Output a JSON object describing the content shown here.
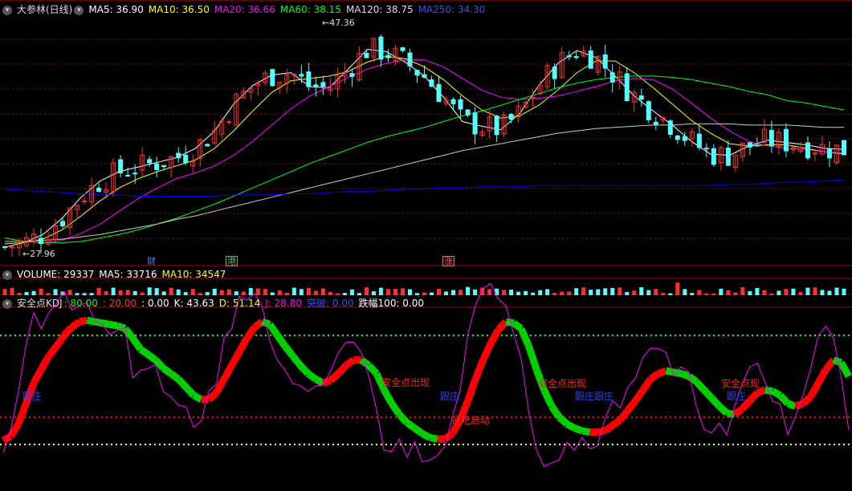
{
  "colors": {
    "background": "#000000",
    "grid": "#7a1010",
    "divider": "#b00000",
    "up_candle": "#ff3030",
    "down_candle": "#54ffff",
    "ma5": "#ffffff",
    "ma10": "#ffff00",
    "ma20": "#ff00ff",
    "ma60": "#00ff00",
    "ma120": "#cccccc",
    "ma250": "#0000ff",
    "kdj_line": "#ff00ff",
    "kdj_up": "#ff0000",
    "kdj_down": "#00d000",
    "level_80": "#00ff00",
    "level_20": "#ff0000",
    "level_0": "#ffff00"
  },
  "price_header": {
    "collapse_icon": "chevron-down-icon",
    "title": "大参林(日线)",
    "ma5": "MA5: 36.90",
    "ma10": "MA10: 36.50",
    "ma20": "MA20: 36.66",
    "ma60": "MA60: 38.15",
    "ma120": "MA120: 38.75",
    "ma250": "MA250: 34.30"
  },
  "volume_header": {
    "collapse_icon": "chevron-down-icon",
    "volume": "VOLUME: 29337",
    "ma5": "MA5: 33716",
    "ma10": "MA10: 34547"
  },
  "kdj_header": {
    "collapse_icon": "chevron-down-icon",
    "title": "安全点KDJ",
    "p80": ": 80.00",
    "p20": ": 20.00",
    "p0": ": 0.00",
    "k": "K: 43.63",
    "d": "D: 51.14",
    "j": "J: 28.80",
    "tp": "突破: 0.00",
    "zf": "跌幅100: 0.00"
  },
  "price_labels": {
    "high": "47.36",
    "low": "27.96"
  },
  "event_tags": [
    {
      "text": "财",
      "color": "#4488ff"
    },
    {
      "text": "港",
      "color": "#30d030"
    },
    {
      "text": "涨",
      "color": "#ff6060"
    }
  ],
  "annotations": [
    {
      "text": "跟庄",
      "color": "#3040ff"
    },
    {
      "text": "安全点出现",
      "color": "#ff2020"
    },
    {
      "text": "跟庄",
      "color": "#3040ff"
    },
    {
      "text": "通吃启动",
      "color": "#ff2020"
    },
    {
      "text": "安全点出现",
      "color": "#ff2020"
    },
    {
      "text": "跟庄跟庄",
      "color": "#3040ff"
    },
    {
      "text": "安全点现",
      "color": "#ff2020"
    },
    {
      "text": "跟庄",
      "color": "#3040ff"
    }
  ],
  "chart_data": {
    "type": "candlestick",
    "bars": 117,
    "price_range": [
      27.0,
      48.5
    ],
    "high_value": 47.36,
    "low_value": 27.96,
    "ma_series": [
      {
        "name": "MA5",
        "values": [
          28.5,
          28.9,
          29.6,
          31.0,
          32.8,
          34.2,
          35.0,
          35.4,
          35.8,
          36.2,
          37.0,
          38.5,
          40.8,
          42.4,
          43.3,
          43.5,
          42.3,
          42.2,
          43.8,
          45.5,
          45.3,
          44.4,
          43.2,
          41.4,
          39.3,
          38.9,
          38.6,
          40.0,
          42.4,
          44.3,
          45.4,
          44.8,
          43.2,
          41.5,
          40.2,
          39.0,
          37.6,
          36.5,
          36.4,
          37.2,
          37.7,
          37.5,
          37.3,
          37.0,
          36.9
        ]
      },
      {
        "name": "MA10",
        "values": [
          28.8,
          28.9,
          29.2,
          30.0,
          31.2,
          32.5,
          33.6,
          34.4,
          35.0,
          35.5,
          36.0,
          37.0,
          38.5,
          40.2,
          41.8,
          42.8,
          43.0,
          43.2,
          43.6,
          44.4,
          44.9,
          44.7,
          44.0,
          42.9,
          41.5,
          40.3,
          39.6,
          39.8,
          40.7,
          42.0,
          43.5,
          44.5,
          44.5,
          43.5,
          42.2,
          40.8,
          39.4,
          38.3,
          37.4,
          37.2,
          37.3,
          37.3,
          37.0,
          36.7,
          36.5
        ]
      },
      {
        "name": "MA20",
        "values": [
          29.3,
          29.0,
          28.9,
          29.1,
          29.7,
          30.5,
          31.6,
          32.7,
          33.6,
          34.4,
          34.9,
          35.5,
          36.4,
          37.6,
          39.0,
          40.4,
          41.5,
          42.3,
          43.1,
          43.8,
          44.3,
          44.6,
          44.6,
          44.0,
          43.0,
          42.0,
          41.4,
          41.2,
          41.3,
          41.5,
          41.9,
          42.3,
          42.8,
          43.0,
          42.9,
          42.1,
          40.9,
          39.6,
          38.5,
          37.6,
          37.2,
          37.0,
          36.9,
          36.7,
          36.6
        ]
      },
      {
        "name": "MA60",
        "values": [
          29.3,
          29.0,
          28.9,
          28.9,
          29.0,
          29.3,
          29.6,
          30.0,
          30.5,
          31.0,
          31.6,
          32.2,
          32.9,
          33.6,
          34.3,
          35.0,
          35.7,
          36.3,
          36.9,
          37.5,
          38.0,
          38.4,
          38.8,
          39.3,
          39.8,
          40.2,
          40.7,
          41.2,
          41.7,
          42.2,
          42.6,
          42.9,
          43.1,
          43.2,
          43.2,
          43.1,
          42.9,
          42.6,
          42.3,
          41.9,
          41.6,
          41.1,
          40.9,
          40.6,
          40.3
        ]
      },
      {
        "name": "MA120",
        "values": [
          29.0,
          29.0,
          29.1,
          29.2,
          29.4,
          29.6,
          29.9,
          30.2,
          30.5,
          30.9,
          31.2,
          31.6,
          32.0,
          32.4,
          32.8,
          33.2,
          33.6,
          34.0,
          34.4,
          34.8,
          35.2,
          35.6,
          36.0,
          36.4,
          36.8,
          37.1,
          37.4,
          37.7,
          38.0,
          38.3,
          38.5,
          38.7,
          38.8,
          38.9,
          39.0,
          39.0,
          39.1,
          39.1,
          39.1,
          39.0,
          39.0,
          39.0,
          38.9,
          38.8,
          38.8
        ]
      },
      {
        "name": "MA250",
        "values": [
          33.5,
          33.4,
          33.3,
          33.2,
          33.1,
          33.0,
          33.0,
          32.9,
          32.9,
          32.9,
          32.9,
          32.9,
          33.0,
          33.0,
          33.0,
          33.1,
          33.1,
          33.2,
          33.3,
          33.3,
          33.4,
          33.5,
          33.5,
          33.6,
          33.6,
          33.7,
          33.7,
          33.7,
          33.8,
          33.8,
          33.8,
          33.8,
          33.8,
          33.8,
          33.8,
          33.8,
          33.8,
          33.8,
          33.9,
          33.9,
          34.0,
          34.1,
          34.1,
          34.2,
          34.3
        ]
      }
    ],
    "kdj_levels": [
      0,
      20,
      80
    ],
    "kdj_k": [
      3,
      6,
      15,
      30,
      45,
      55,
      65,
      72,
      80,
      86,
      90,
      91,
      90,
      89,
      88,
      87,
      85,
      78,
      70,
      66,
      62,
      56,
      52,
      48,
      42,
      36,
      33,
      33,
      38,
      48,
      58,
      68,
      78,
      86,
      90,
      88,
      80,
      72,
      65,
      58,
      52,
      48,
      45,
      47,
      52,
      58,
      62,
      62,
      58,
      52,
      40,
      30,
      22,
      16,
      12,
      8,
      5,
      4,
      4,
      8,
      18,
      32,
      48,
      62,
      74,
      84,
      90,
      89,
      85,
      72,
      55,
      40,
      28,
      20,
      15,
      12,
      10,
      9,
      9,
      10,
      14,
      18,
      25,
      32,
      40,
      48,
      52,
      54,
      53,
      52,
      50,
      46,
      40,
      34,
      28,
      23,
      22,
      26,
      32,
      38,
      40,
      39,
      36,
      30,
      28,
      30,
      35,
      45,
      55,
      62,
      60,
      50
    ]
  }
}
